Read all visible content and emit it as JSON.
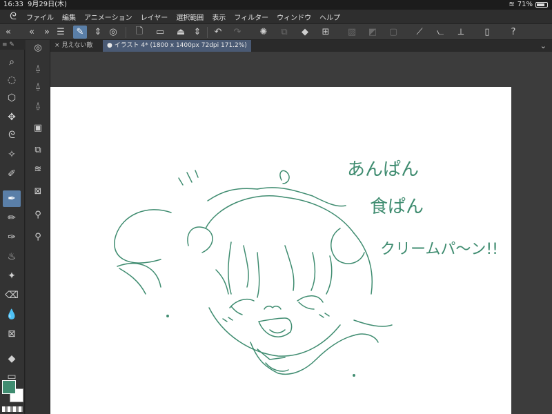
{
  "status": {
    "time": "16:33",
    "date": "9月29日(木)",
    "battery": "71%"
  },
  "menu": [
    "ファイル",
    "編集",
    "アニメーション",
    "レイヤー",
    "選択範囲",
    "表示",
    "フィルター",
    "ウィンドウ",
    "ヘルプ"
  ],
  "tabs": {
    "inactive": "× 見えない敵",
    "active": "● イラスト 4* (1800 x 1400px 72dpi 171.2%)"
  },
  "colors": {
    "main": "#3f8c70",
    "sub": "#ffffff",
    "accent": "#5a7fa8"
  },
  "canvas_text": {
    "line1": "あんぱん",
    "line2": "食ぱん",
    "line3": "クリームパ〜ン!!"
  }
}
